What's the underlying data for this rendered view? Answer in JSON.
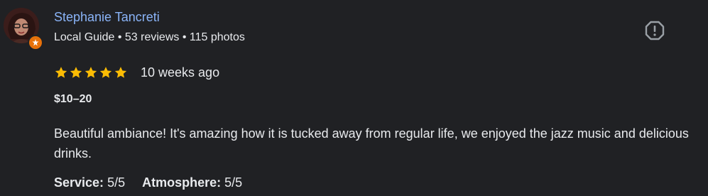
{
  "reviewer": {
    "name": "Stephanie Tancreti",
    "badge": "Local Guide",
    "separator1": "•",
    "reviews": "53 reviews",
    "separator2": "•",
    "photos": "115 photos"
  },
  "review": {
    "rating": 5,
    "max_rating": 5,
    "date": "10 weeks ago",
    "price": "$10–20",
    "text": "Beautiful ambiance! It's amazing how it is tucked away from regular life, we enjoyed the jazz music and delicious drinks.",
    "attributes": [
      {
        "label": "Service:",
        "value": "5/5"
      },
      {
        "label": "Atmosphere:",
        "value": "5/5"
      }
    ]
  },
  "icons": {
    "report": "report-flag-icon",
    "star": "star-icon",
    "local_guide": "local-guide-badge-icon"
  },
  "colors": {
    "background": "#202124",
    "name": "#8ab4f8",
    "text": "#e8eaed",
    "star": "#fbbc04",
    "badge": "#e8710a",
    "icon": "#9aa0a6"
  }
}
